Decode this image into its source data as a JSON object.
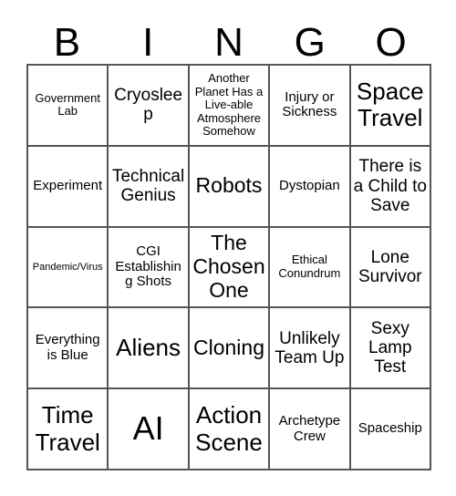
{
  "card": {
    "header_letters": [
      "B",
      "I",
      "N",
      "G",
      "O"
    ],
    "columns": 5,
    "rows": 5,
    "colors": {
      "background": "#ffffff",
      "text": "#000000",
      "grid_line": "#555555"
    },
    "cells": [
      {
        "text": "Government Lab",
        "size": "fs-s"
      },
      {
        "text": "Cryosleep",
        "size": "fs-l"
      },
      {
        "text": "Another Planet Has a Live-able Atmosphere Somehow",
        "size": "fs-s"
      },
      {
        "text": "Injury or Sickness",
        "size": "fs-m"
      },
      {
        "text": "Space Travel",
        "size": "fs-xxl"
      },
      {
        "text": "Experiment",
        "size": "fs-m"
      },
      {
        "text": "Technical Genius",
        "size": "fs-l"
      },
      {
        "text": "Robots",
        "size": "fs-xl"
      },
      {
        "text": "Dystopian",
        "size": "fs-m"
      },
      {
        "text": "There is a Child to Save",
        "size": "fs-l"
      },
      {
        "text": "Pandemic/Virus",
        "size": "fs-xs"
      },
      {
        "text": "CGI Establishing Shots",
        "size": "fs-m"
      },
      {
        "text": "The Chosen One",
        "size": "fs-xl"
      },
      {
        "text": "Ethical Conundrum",
        "size": "fs-s"
      },
      {
        "text": "Lone Survivor",
        "size": "fs-l"
      },
      {
        "text": "Everything is Blue",
        "size": "fs-m"
      },
      {
        "text": "Aliens",
        "size": "fs-xxl"
      },
      {
        "text": "Cloning",
        "size": "fs-xl"
      },
      {
        "text": "Unlikely Team Up",
        "size": "fs-l"
      },
      {
        "text": "Sexy Lamp Test",
        "size": "fs-l"
      },
      {
        "text": "Time Travel",
        "size": "fs-xxl"
      },
      {
        "text": "AI",
        "size": "fs-huge"
      },
      {
        "text": "Action Scene",
        "size": "fs-xxl"
      },
      {
        "text": "Archetype Crew",
        "size": "fs-m"
      },
      {
        "text": "Spaceship",
        "size": "fs-m"
      }
    ]
  }
}
